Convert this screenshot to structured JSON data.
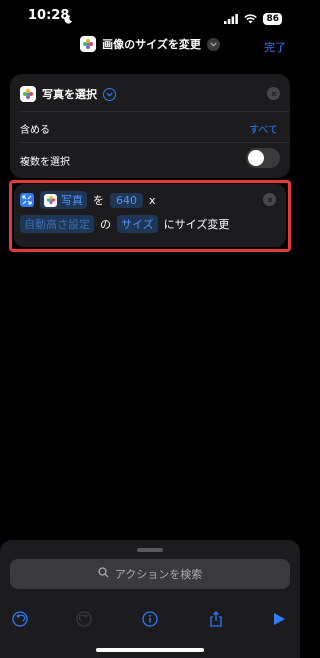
{
  "status": {
    "time": "10:28",
    "battery": "86"
  },
  "nav": {
    "title": "画像のサイズを変更",
    "done_label": "完了"
  },
  "select_action": {
    "title": "写真を選択",
    "include_label": "含める",
    "include_value": "すべて",
    "multiple_label": "複数を選択",
    "multiple_enabled": false
  },
  "resize_action": {
    "photos_token": "写真",
    "particle_wo": "を",
    "width_value": "640",
    "times": "x",
    "height_token": "自動高さ設定",
    "particle_no": "の",
    "size_token": "サイズ",
    "suffix": "にサイズ変更"
  },
  "bottom_sheet": {
    "search_placeholder": "アクションを検索"
  },
  "colors": {
    "accent": "#2f7cf6",
    "highlight": "#e33b3b"
  }
}
